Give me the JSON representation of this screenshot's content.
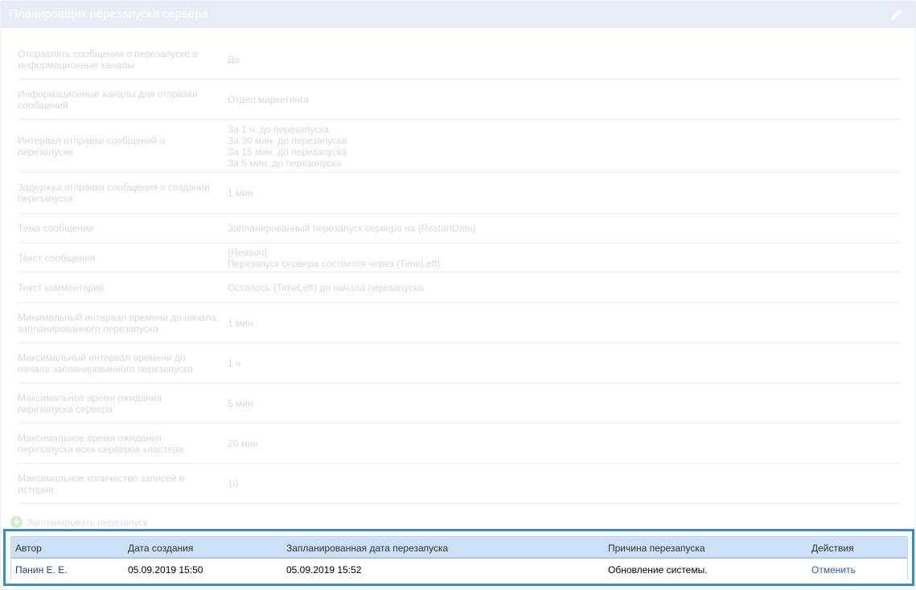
{
  "title": "Планировщик перезапуска сервера",
  "properties": [
    {
      "label": "Отправлять сообщения о перезапуске в информационные каналы",
      "value": "Да"
    },
    {
      "label": "Информационные каналы для отправки сообщений",
      "value": "Отдел маркетинга"
    },
    {
      "label": "Интервал отправки сообщений о перезапуске",
      "value": "За 1 ч. до перезапуска\nЗа 30 мин. до перезапуска\nЗа 15 мин. до перезапуска\nЗа 5 мин. до перезапуска"
    },
    {
      "label": "Задержка отправки сообщения о создании перезапуска",
      "value": "1 мин"
    },
    {
      "label": "Тема сообщения",
      "value": "Запланированный перезапуск сервера на {RestartDate}"
    },
    {
      "label": "Текст сообщения",
      "value": "{Reason}\nПерезапуск сервера состоится через {TimeLeft}"
    },
    {
      "label": "Текст комментария",
      "value": "Осталось {TimeLeft} до начала перезапуска."
    },
    {
      "label": "Минимальный интервал времени до начала запланированного перезапуска",
      "value": "1 мин"
    },
    {
      "label": "Максимальный интервал времени до начала запланированного перезапуска",
      "value": "1 ч"
    },
    {
      "label": "Максимальное время ожидания перезапуска сервера",
      "value": "5 мин"
    },
    {
      "label": "Максимальное время ожидания перезапуска всех серверов кластера",
      "value": "20 мин"
    },
    {
      "label": "Максимальное количество записей в истории",
      "value": "10"
    }
  ],
  "schedule_label": "Запланировать перезапуск",
  "table": {
    "headers": [
      "Автор",
      "Дата создания",
      "Запланированная дата перезапуска",
      "Причина перезапуска",
      "Действия"
    ],
    "rows": [
      {
        "author": "Панин Е. Е.",
        "created": "05.09.2019 15:50",
        "scheduled": "05.09.2019 15:52",
        "reason": "Обновление системы.",
        "action": "Отменить"
      }
    ]
  }
}
